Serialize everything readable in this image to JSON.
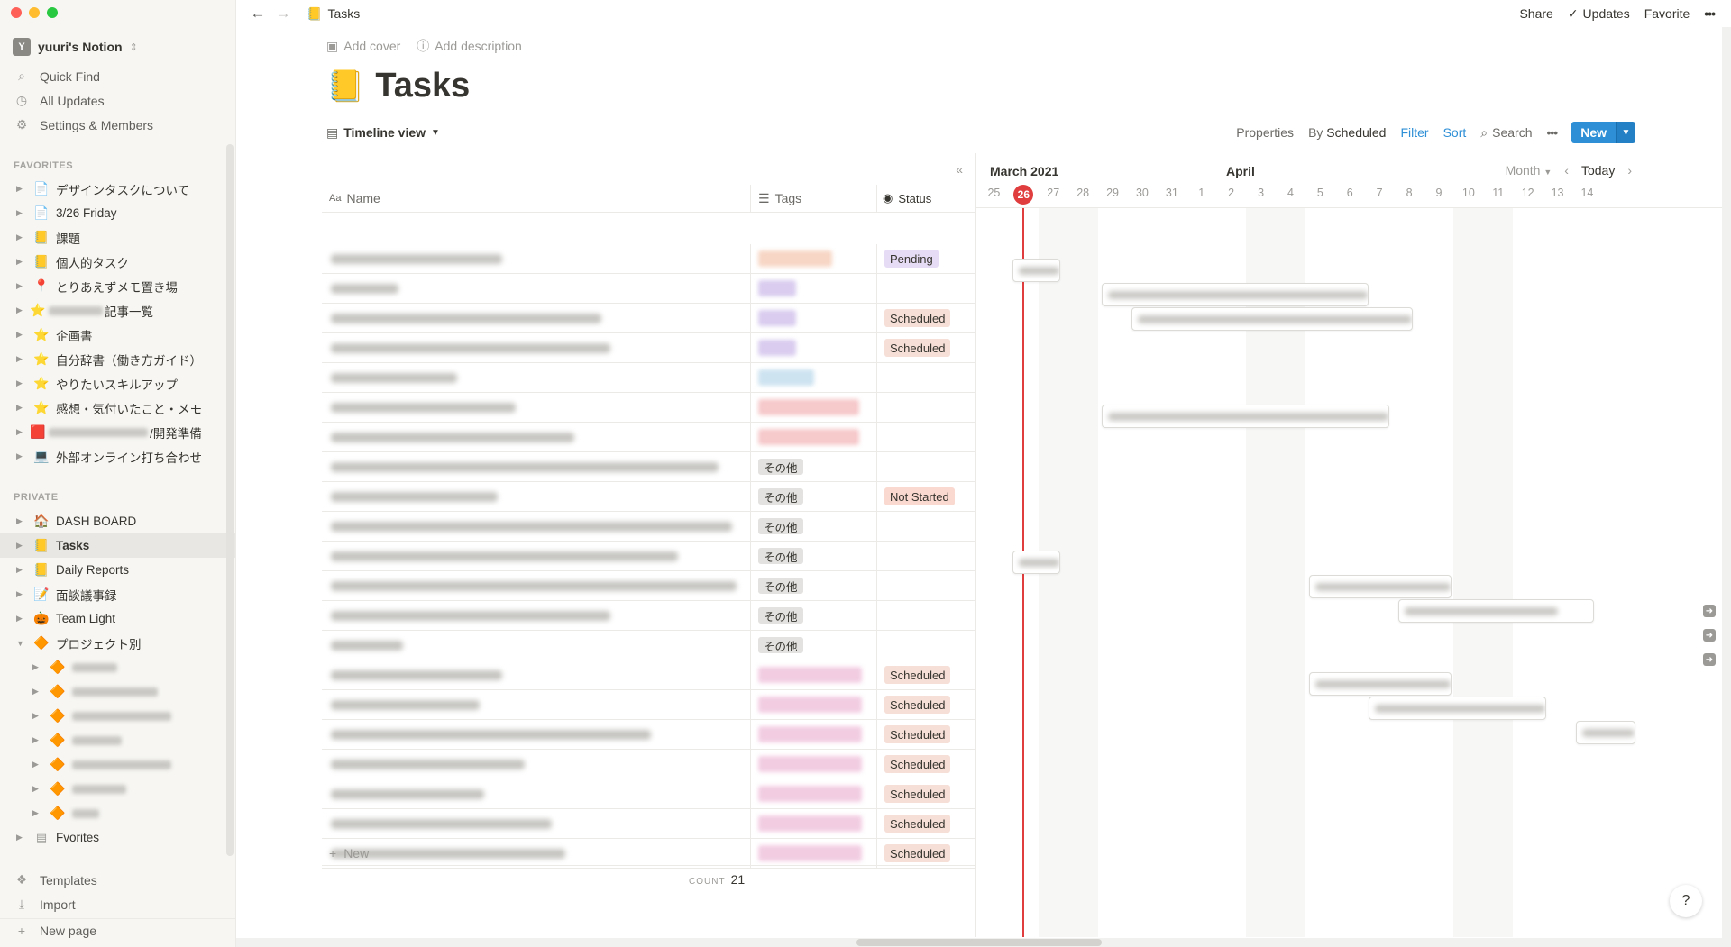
{
  "workspace": {
    "badge": "Y",
    "name": "yuuri's Notion",
    "chevron": "⇕"
  },
  "nav": [
    {
      "icon": "search-icon",
      "glyph": "⌕",
      "label": "Quick Find"
    },
    {
      "icon": "clock-icon",
      "glyph": "◷",
      "label": "All Updates"
    },
    {
      "icon": "gear-icon",
      "glyph": "⚙",
      "label": "Settings & Members"
    }
  ],
  "sections": {
    "favorites": "FAVORITES",
    "private": "PRIVATE"
  },
  "favorites": [
    {
      "emoji": "📄",
      "label": "デザインタスクについて"
    },
    {
      "emoji": "📄",
      "label": "3/26 Friday"
    },
    {
      "emoji": "📒",
      "label": "課題"
    },
    {
      "emoji": "📒",
      "label": "個人的タスク"
    },
    {
      "emoji": "📍",
      "label": "とりあえずメモ置き場"
    },
    {
      "emoji": "⭐",
      "label": "記事一覧",
      "blur_prefix": 60
    },
    {
      "emoji": "⭐",
      "label": "企画書"
    },
    {
      "emoji": "⭐",
      "label": "自分辞書（働き方ガイド）"
    },
    {
      "emoji": "⭐",
      "label": "やりたいスキルアップ"
    },
    {
      "emoji": "⭐",
      "label": "感想・気付いたこと・メモ"
    },
    {
      "emoji": "🟥",
      "label": "/開発準備",
      "blur_prefix": 110
    },
    {
      "emoji": "💻",
      "label": "外部オンライン打ち合わせ"
    }
  ],
  "private": [
    {
      "emoji": "🏠",
      "label": "DASH BOARD"
    },
    {
      "emoji": "📒",
      "label": "Tasks",
      "active": true
    },
    {
      "emoji": "📒",
      "label": "Daily Reports"
    },
    {
      "emoji": "📝",
      "label": "面談議事録"
    },
    {
      "emoji": "🎃",
      "label": "Team Light"
    },
    {
      "emoji": "🔶",
      "label": "プロジェクト別",
      "open": true
    }
  ],
  "project_children": [
    {
      "emoji": "🔶",
      "blur": 50
    },
    {
      "emoji": "🔶",
      "blur": 95
    },
    {
      "emoji": "🔶",
      "blur": 110
    },
    {
      "emoji": "🔶",
      "blur": 55
    },
    {
      "emoji": "🔶",
      "blur": 110
    },
    {
      "emoji": "🔶",
      "blur": 60
    },
    {
      "emoji": "🔶",
      "blur": 30
    }
  ],
  "fvorites": {
    "label": "Fvorites"
  },
  "bottom": [
    {
      "icon": "templates-icon",
      "glyph": "❖",
      "label": "Templates"
    },
    {
      "icon": "import-icon",
      "glyph": "⤓",
      "label": "Import"
    },
    {
      "icon": "plus-icon",
      "glyph": "+",
      "label": "New page"
    }
  ],
  "topbar": {
    "breadcrumb_emoji": "📒",
    "breadcrumb": "Tasks",
    "share": "Share",
    "updates": "Updates",
    "favorite": "Favorite",
    "more": "•••"
  },
  "page": {
    "add_cover": "Add cover",
    "add_description": "Add description",
    "emoji": "📒",
    "title": "Tasks"
  },
  "toolbar": {
    "view": "Timeline view",
    "properties": "Properties",
    "by_prefix": "By",
    "by_value": "Scheduled",
    "filter": "Filter",
    "sort": "Sort",
    "search": "Search",
    "more": "•••",
    "new": "New"
  },
  "table": {
    "headers": {
      "name": "Name",
      "tags": "Tags",
      "status": "Status"
    },
    "rows": [
      {
        "name_w": 190,
        "tag": {
          "color": "orange",
          "text": "",
          "w": 82
        },
        "status": "Pending"
      },
      {
        "name_w": 75,
        "tag": {
          "color": "purple",
          "text": "",
          "w": 42
        },
        "status": ""
      },
      {
        "name_w": 300,
        "tag": {
          "color": "purple",
          "text": "",
          "w": 42
        },
        "status": "Scheduled"
      },
      {
        "name_w": 310,
        "tag": {
          "color": "purple",
          "text": "",
          "w": 42
        },
        "status": "Scheduled"
      },
      {
        "name_w": 140,
        "tag": {
          "color": "blue",
          "text": "",
          "w": 62
        },
        "status": ""
      },
      {
        "name_w": 205,
        "tag": {
          "color": "red",
          "text": "",
          "w": 112
        },
        "status": ""
      },
      {
        "name_w": 270,
        "tag": {
          "color": "red",
          "text": "",
          "w": 112
        },
        "status": ""
      },
      {
        "name_w": 430,
        "tag": {
          "color": "gray",
          "text": "その他"
        },
        "status": ""
      },
      {
        "name_w": 185,
        "tag": {
          "color": "gray",
          "text": "その他"
        },
        "status": "Not Started"
      },
      {
        "name_w": 445,
        "tag": {
          "color": "gray",
          "text": "その他"
        },
        "status": ""
      },
      {
        "name_w": 385,
        "tag": {
          "color": "gray",
          "text": "その他"
        },
        "status": ""
      },
      {
        "name_w": 450,
        "tag": {
          "color": "gray",
          "text": "その他"
        },
        "status": ""
      },
      {
        "name_w": 310,
        "tag": {
          "color": "gray",
          "text": "その他"
        },
        "status": ""
      },
      {
        "name_w": 80,
        "tag": {
          "color": "gray",
          "text": "その他"
        },
        "status": ""
      },
      {
        "name_w": 190,
        "tag": {
          "color": "pink",
          "text": "",
          "w": 115
        },
        "status": "Scheduled"
      },
      {
        "name_w": 165,
        "tag": {
          "color": "pink",
          "text": "",
          "w": 115
        },
        "status": "Scheduled"
      },
      {
        "name_w": 355,
        "tag": {
          "color": "pink",
          "text": "",
          "w": 115
        },
        "status": "Scheduled"
      },
      {
        "name_w": 215,
        "tag": {
          "color": "pink",
          "text": "",
          "w": 115
        },
        "status": "Scheduled"
      },
      {
        "name_w": 170,
        "tag": {
          "color": "pink",
          "text": "",
          "w": 115
        },
        "status": "Scheduled"
      },
      {
        "name_w": 245,
        "tag": {
          "color": "pink",
          "text": "",
          "w": 115
        },
        "status": "Scheduled"
      },
      {
        "name_w": 260,
        "tag": {
          "color": "pink",
          "text": "",
          "w": 115
        },
        "status": "Scheduled"
      }
    ],
    "new_label": "New",
    "count_label": "COUNT",
    "count_value": "21"
  },
  "timeline": {
    "month1": "March 2021",
    "month2": "April",
    "scale": "Month",
    "today": "Today",
    "days": [
      "25",
      "26",
      "27",
      "28",
      "29",
      "30",
      "31",
      "1",
      "2",
      "3",
      "4",
      "5",
      "6",
      "7",
      "8",
      "9",
      "10",
      "11",
      "12",
      "13",
      "14"
    ],
    "today_day": "26",
    "weekends": [
      [
        "27",
        "28"
      ],
      [
        "3",
        "4"
      ],
      [
        "10",
        "11"
      ]
    ],
    "bars": [
      {
        "row": 1,
        "start": "26",
        "days": 1.6,
        "text_w": 60
      },
      {
        "row": 2,
        "start": "29",
        "days": 9.0,
        "text_w": 360
      },
      {
        "row": 3,
        "start": "30",
        "days": 9.5,
        "text_w": 370
      },
      {
        "row": 7,
        "start": "29",
        "days": 9.7,
        "text_w": 380
      },
      {
        "row": 13,
        "start": "26",
        "days": 1.6,
        "text_w": 55
      },
      {
        "row": 14,
        "start": "5",
        "days": 4.8,
        "text_w": 190
      },
      {
        "row": 15,
        "start": "8",
        "days": 6.6,
        "text_w": 170,
        "arrow": true
      },
      {
        "row": 16,
        "arrow_only": true
      },
      {
        "row": 17,
        "arrow_only": true
      },
      {
        "row": 18,
        "start": "5",
        "days": 4.8,
        "text_w": 165
      },
      {
        "row": 19,
        "start": "7",
        "days": 6.0,
        "text_w": 230
      },
      {
        "row": 20,
        "start": "14",
        "days": 2.0,
        "text_w": 60
      }
    ]
  },
  "help": "?",
  "colors": {
    "accent": "#2e8fd6",
    "today_red": "#e03e3e",
    "sidebar_bg": "#f7f6f3"
  }
}
